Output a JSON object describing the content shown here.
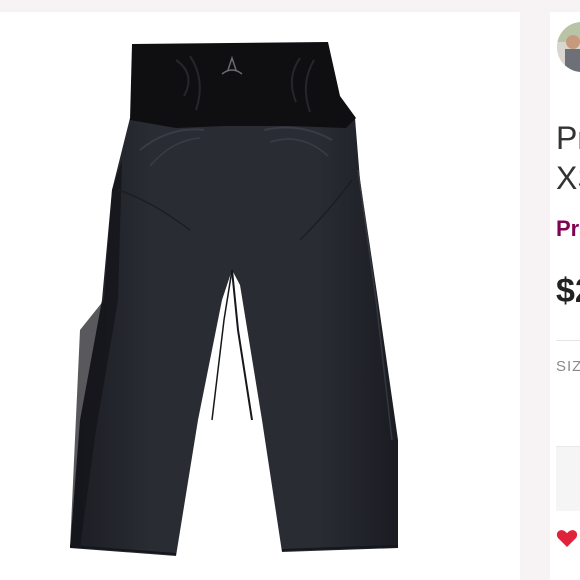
{
  "listing": {
    "title_line1": "Pr",
    "title_line2": "XS",
    "brand": "Pra",
    "price": "$2",
    "size_label": "SIZ"
  },
  "icons": {
    "like": "heart-icon",
    "seller_avatar": "avatar"
  },
  "colors": {
    "brand": "#7f0353",
    "like": "#e0223a",
    "pants": "#23252c"
  }
}
